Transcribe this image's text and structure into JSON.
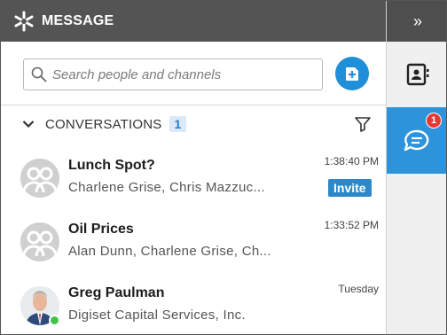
{
  "header": {
    "title": "MESSAGE",
    "logo_icon": "asterisk-logo-icon"
  },
  "search": {
    "placeholder": "Search people and channels",
    "value": ""
  },
  "compose": {
    "icon": "compose-plus-icon"
  },
  "conversations_section": {
    "label": "CONVERSATIONS",
    "count": "1"
  },
  "conversations": [
    {
      "name": "Lunch Spot?",
      "members": "Charlene Grise,  Chris Mazzuc...",
      "time": "1:38:40 PM",
      "action": "Invite"
    },
    {
      "name": "Oil Prices",
      "members": "Alan Dunn,  Charlene Grise,  Ch...",
      "time": "1:33:52 PM"
    },
    {
      "name": "Greg Paulman",
      "members": "Digiset Capital Services, Inc.",
      "time": "Tuesday",
      "status": "online"
    }
  ],
  "rail": {
    "collapse": "»",
    "chat_badge": "1"
  },
  "colors": {
    "header_bg": "#545454",
    "accent": "#2d93db",
    "badge": "#e53935",
    "online": "#3ec54a"
  }
}
